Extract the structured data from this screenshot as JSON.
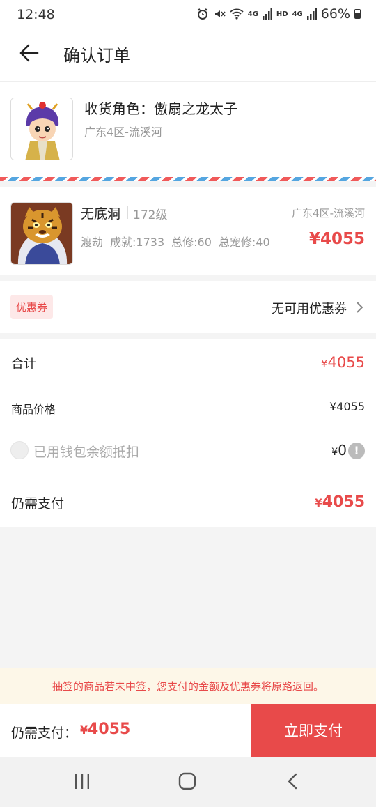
{
  "status_bar": {
    "time": "12:48",
    "battery": "66%",
    "network": "4G",
    "hd": "HD"
  },
  "header": {
    "title": "确认订单"
  },
  "receiver": {
    "name": "收货角色：傲扇之龙太子",
    "server": "广东4区-流溪河"
  },
  "product": {
    "name": "无底洞",
    "level": "172级",
    "server": "广东4区-流溪河",
    "stats": [
      "渡劫",
      "成就:1733",
      "总修:60",
      "总宠修:40"
    ],
    "price": "¥4055"
  },
  "coupon": {
    "tag": "优惠券",
    "value": "无可用优惠券"
  },
  "summary": {
    "total_label": "合计",
    "total_yen": "¥",
    "total_value": "4055",
    "price_label": "商品价格",
    "price_value": "¥4055",
    "wallet_label": "已用钱包余额抵扣",
    "wallet_yen": "¥",
    "wallet_value": "0",
    "info_mark": "!",
    "due_label": "仍需支付",
    "due_yen": "¥",
    "due_value": "4055"
  },
  "notice": "抽签的商品若未中签，您支付的金额及优惠券将原路返回。",
  "paybar": {
    "label": "仍需支付：",
    "yen": "¥",
    "amount": "4055",
    "button": "立即支付"
  },
  "colors": {
    "accent": "#e84a4a",
    "coupon_bg": "#fde8e8",
    "notice_bg": "#fdf7e8"
  }
}
